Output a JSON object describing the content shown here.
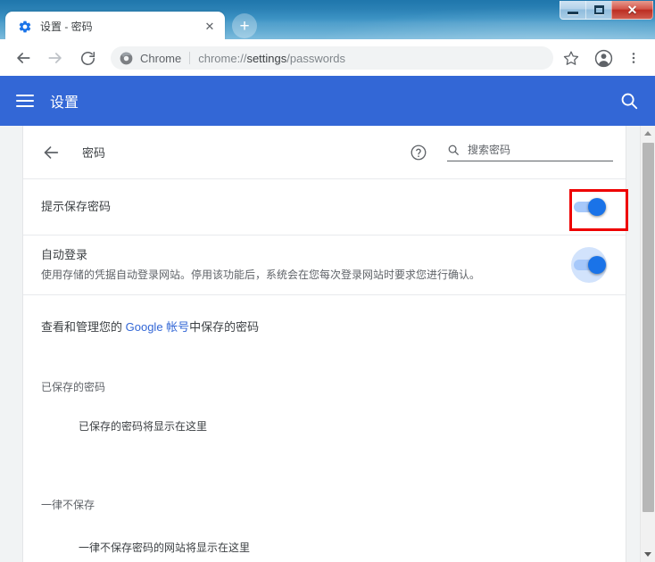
{
  "window": {
    "controls": {
      "minimize_label": "最小化",
      "maximize_label": "最大化",
      "close_label": "✕"
    }
  },
  "tabs": [
    {
      "title": "设置 - 密码",
      "favicon": "settings-gear-icon",
      "close_label": "✕",
      "active": true
    }
  ],
  "new_tab_label": "+",
  "toolbar": {
    "back_label": "←",
    "forward_label": "→",
    "reload_label": "⟳",
    "omnibox": {
      "icon": "chrome-logo-icon",
      "scheme_label": "Chrome",
      "url_prefix": "chrome://",
      "url_strong": "settings",
      "url_suffix": "/passwords",
      "full_url": "chrome://settings/passwords"
    },
    "bookmark_icon": "star-icon",
    "profile_icon": "account-avatar-icon",
    "menu_icon": "three-dot-menu-icon"
  },
  "settings_header": {
    "menu_icon": "hamburger-menu-icon",
    "title": "设置",
    "search_icon": "search-icon"
  },
  "sub_header": {
    "back_icon": "back-arrow-icon",
    "title": "密码",
    "help_icon": "help-circle-icon",
    "search_icon": "search-icon",
    "search_placeholder": "搜索密码",
    "search_value": ""
  },
  "rows": [
    {
      "title": "提示保存密码",
      "subtitle": "",
      "toggle_on": true,
      "focused": false,
      "highlighted": true
    },
    {
      "title": "自动登录",
      "subtitle": "使用存储的凭据自动登录网站。停用该功能后，系统会在您每次登录网站时要求您进行确认。",
      "toggle_on": true,
      "focused": true,
      "highlighted": false
    }
  ],
  "manage_link_row": {
    "prefix": "查看和管理您的 ",
    "link_text": "Google 帐号",
    "suffix": "中保存的密码"
  },
  "saved_section": {
    "label": "已保存的密码",
    "empty_text": "已保存的密码将显示在这里"
  },
  "never_saved_section": {
    "label": "一律不保存",
    "empty_text": "一律不保存密码的网站将显示在这里"
  },
  "scrollbar": {
    "up_arrow": "scroll-up-arrow",
    "down_arrow": "scroll-down-arrow"
  },
  "colors": {
    "chrome_blue": "#3367d6",
    "toggle_on": "#1a73e8",
    "toggle_track": "#a6c8fa",
    "focus_ring": "#d2e3fc",
    "link": "#3367d6",
    "annotation_red": "#ee0000",
    "titlebar_blue": "#2a80b4"
  }
}
